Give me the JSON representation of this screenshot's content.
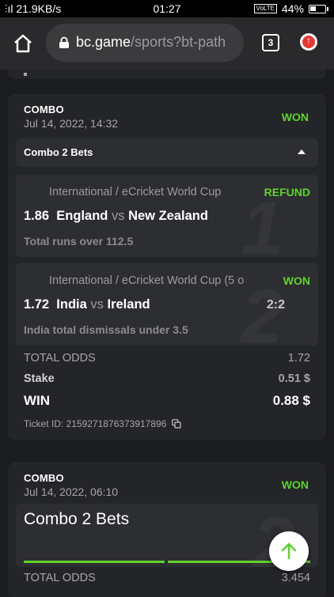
{
  "statusbar": {
    "speed": "21.9KB/s",
    "time": "01:27",
    "network": "VoLTE",
    "battery": "44%",
    "battery_level": 0.44
  },
  "browser": {
    "url_host": "bc.game",
    "url_path": "/sports?bt-path",
    "tab_count": "3"
  },
  "colors": {
    "accent_green": "#5fd32e",
    "card_bg": "#242528",
    "page_bg": "#1b1c1e"
  },
  "tickets": [
    {
      "type": "COMBO",
      "date": "Jul 14, 2022, 14:32",
      "result": "WON",
      "section_title": "Combo 2 Bets",
      "bets": [
        {
          "league": "International / eCricket World Cup",
          "status": "REFUND",
          "odds": "1.86",
          "home": "England",
          "vs": "vs",
          "away": "New Zealand",
          "market": "Total runs over 112.5",
          "index": "1"
        },
        {
          "league": "International / eCricket World Cup (5 o",
          "status": "WON",
          "odds": "1.72",
          "home": "India",
          "vs": "vs",
          "away": "Ireland",
          "score": "2:2",
          "market": "India total dismissals under 3.5",
          "index": "2"
        }
      ],
      "total_odds_label": "TOTAL ODDS",
      "total_odds": "1.72",
      "stake_label": "Stake",
      "stake": "0.51 $",
      "win_label": "WIN",
      "win": "0.88 $",
      "ticket_id": "Ticket ID: 2159271876373917896"
    },
    {
      "type": "COMBO",
      "date": "Jul 14, 2022, 06:10",
      "result": "WON",
      "section_title": "Combo 2 Bets",
      "index": "2",
      "total_odds_label": "TOTAL ODDS",
      "total_odds": "3.454"
    }
  ]
}
